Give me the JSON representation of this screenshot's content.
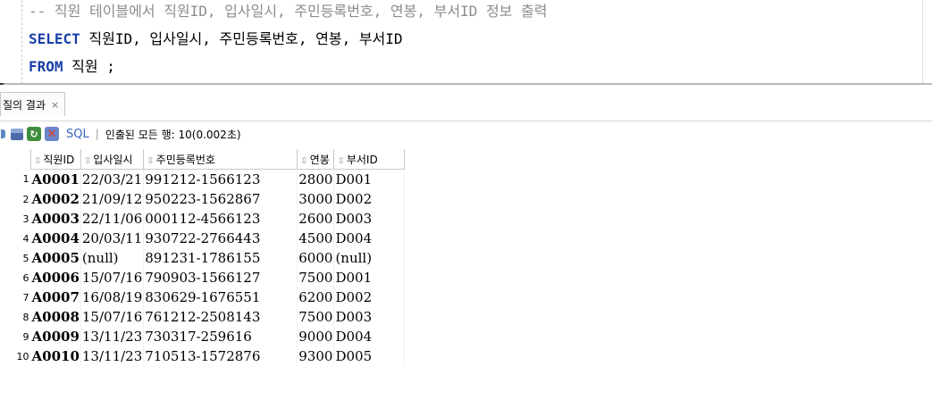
{
  "editor": {
    "line1": "-- 직원 테이블에서 직원ID, 입사일시, 주민등록번호, 연봉, 부서ID 정보 출력",
    "select_kw": "SELECT",
    "line2_rest": " 직원ID, 입사일시, 주민등록번호, 연봉, 부서ID",
    "from_kw": "FROM",
    "line3_rest": " 직원 ;"
  },
  "result_tab": {
    "label": "질의 결과",
    "close": "×"
  },
  "toolbar": {
    "sql_label": "SQL",
    "separator": "|",
    "status": "인출된 모든 행: 10(0.002초)",
    "icons": [
      "pin-icon",
      "print-icon",
      "refresh-icon",
      "cancel-icon"
    ]
  },
  "grid": {
    "sort_glyph": "⇳",
    "columns": [
      "직원ID",
      "입사일시",
      "주민등록번호",
      "연봉",
      "부서ID"
    ],
    "rows": [
      {
        "n": "1",
        "id": "A0001",
        "date": "22/03/21",
        "rrn": "991212-1566123",
        "salary": "2800",
        "dept": "D001"
      },
      {
        "n": "2",
        "id": "A0002",
        "date": "21/09/12",
        "rrn": "950223-1562867",
        "salary": "3000",
        "dept": "D002"
      },
      {
        "n": "3",
        "id": "A0003",
        "date": "22/11/06",
        "rrn": "000112-4566123",
        "salary": "2600",
        "dept": "D003"
      },
      {
        "n": "4",
        "id": "A0004",
        "date": "20/03/11",
        "rrn": "930722-2766443",
        "salary": "4500",
        "dept": "D004"
      },
      {
        "n": "5",
        "id": "A0005",
        "date": "(null)",
        "rrn": "891231-1786155",
        "salary": "6000",
        "dept": "(null)"
      },
      {
        "n": "6",
        "id": "A0006",
        "date": "15/07/16",
        "rrn": "790903-1566127",
        "salary": "7500",
        "dept": "D001"
      },
      {
        "n": "7",
        "id": "A0007",
        "date": "16/08/19",
        "rrn": "830629-1676551",
        "salary": "6200",
        "dept": "D002"
      },
      {
        "n": "8",
        "id": "A0008",
        "date": "15/07/16",
        "rrn": "761212-2508143",
        "salary": "7500",
        "dept": "D003"
      },
      {
        "n": "9",
        "id": "A0009",
        "date": "13/11/23",
        "rrn": "730317-259616",
        "salary": "9000",
        "dept": "D004"
      },
      {
        "n": "10",
        "id": "A0010",
        "date": "13/11/23",
        "rrn": "710513-1572876",
        "salary": "9300",
        "dept": "D005"
      }
    ]
  }
}
